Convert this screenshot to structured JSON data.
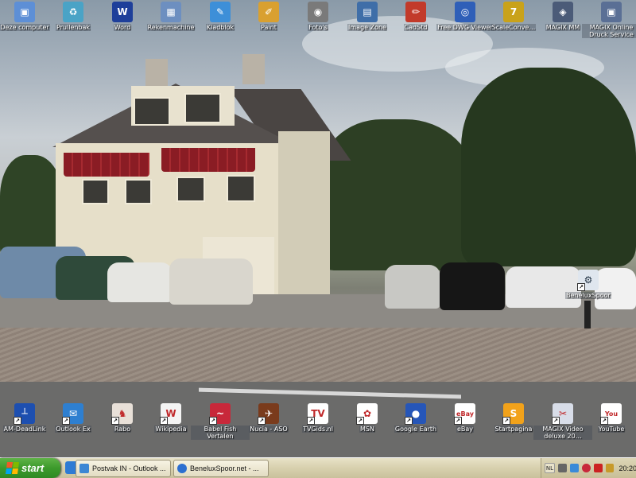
{
  "desktop": {
    "top_icons": [
      {
        "label": "Deze computer",
        "icon": "my-computer-icon",
        "color": "#5d8fd6",
        "glyph": "▣"
      },
      {
        "label": "Prullenbak",
        "icon": "recycle-bin-icon",
        "color": "#4aa3c6",
        "glyph": "♻"
      },
      {
        "label": "Word",
        "icon": "word-icon",
        "color": "#1e3f9a",
        "glyph": "W"
      },
      {
        "label": "Rekenmachine",
        "icon": "calculator-icon",
        "color": "#6d8fc0",
        "glyph": "▦"
      },
      {
        "label": "Kladblok",
        "icon": "notepad-icon",
        "color": "#3d8fd8",
        "glyph": "✎"
      },
      {
        "label": "Paint",
        "icon": "paint-icon",
        "color": "#d9a030",
        "glyph": "✐"
      },
      {
        "label": "Foto's",
        "icon": "camera-icon",
        "color": "#7a7a7a",
        "glyph": "◉"
      },
      {
        "label": "Image Zone",
        "icon": "image-zone-icon",
        "color": "#3f6ea8",
        "glyph": "▤"
      },
      {
        "label": "CadStd",
        "icon": "cadstd-icon",
        "color": "#c23a2a",
        "glyph": "✏"
      },
      {
        "label": "Free DWG Viewer",
        "icon": "dwg-viewer-icon",
        "color": "#2f5fb8",
        "glyph": "◎"
      },
      {
        "label": "ScaleConve…",
        "icon": "scale-converter-icon",
        "color": "#c9a21a",
        "glyph": "7"
      },
      {
        "label": "MAGIX MM",
        "icon": "magix-mm-icon",
        "color": "#4b5b78",
        "glyph": "◈"
      },
      {
        "label": "MAGIX Online Druck Service",
        "icon": "magix-druck-icon",
        "color": "#5a6f95",
        "glyph": "▣"
      }
    ],
    "bottom_icons": [
      {
        "label": "AM-DeadLink",
        "icon": "deadlink-icon",
        "color": "#1d4fb0",
        "glyph": "┴"
      },
      {
        "label": "Outlook Ex",
        "icon": "outlook-express-icon",
        "color": "#2e7fd0",
        "glyph": "✉"
      },
      {
        "label": "Rabo",
        "icon": "rabo-icon",
        "color": "#e8e0d8",
        "glyph": "♞"
      },
      {
        "label": "Wikipedia",
        "icon": "wikipedia-icon",
        "color": "#f4f4f4",
        "glyph": "W"
      },
      {
        "label": "Babel Fish Vertalen",
        "icon": "babelfish-icon",
        "color": "#c8283a",
        "glyph": "~"
      },
      {
        "label": "Nucia - ASO",
        "icon": "nucia-icon",
        "color": "#7a3b1c",
        "glyph": "✈"
      },
      {
        "label": "TVGids.nl",
        "icon": "tvgids-icon",
        "color": "#ffffff",
        "glyph": "TV"
      },
      {
        "label": "MSN",
        "icon": "msn-icon",
        "color": "#ffffff",
        "glyph": "✿"
      },
      {
        "label": "Google Earth",
        "icon": "google-earth-icon",
        "color": "#2656b8",
        "glyph": "●"
      },
      {
        "label": "eBay",
        "icon": "ebay-icon",
        "color": "#ffffff",
        "glyph": "eBay"
      },
      {
        "label": "Startpagina",
        "icon": "startpagina-icon",
        "color": "#f2a21a",
        "glyph": "S"
      },
      {
        "label": "MAGIX Video deluxe 20…",
        "icon": "magix-video-icon",
        "color": "#d8dde8",
        "glyph": "✂"
      },
      {
        "label": "YouTube",
        "icon": "youtube-icon",
        "color": "#ffffff",
        "glyph": "You"
      }
    ],
    "floating_icon": {
      "label": "BeneluxSpoor",
      "icon": "beneluxspoor-icon",
      "color": "#dfe6ee",
      "glyph": "⚙"
    }
  },
  "taskbar": {
    "start_label": "start",
    "tasks": [
      {
        "label": "Postvak IN - Outlook ...",
        "icon": "outlook-task-icon",
        "color": "#3d87d4"
      },
      {
        "label": "BeneluxSpoor.net - ...",
        "icon": "ie-task-icon",
        "color": "#2d6fd0"
      }
    ],
    "tray": {
      "language": "NL",
      "clock": "20:20"
    }
  }
}
